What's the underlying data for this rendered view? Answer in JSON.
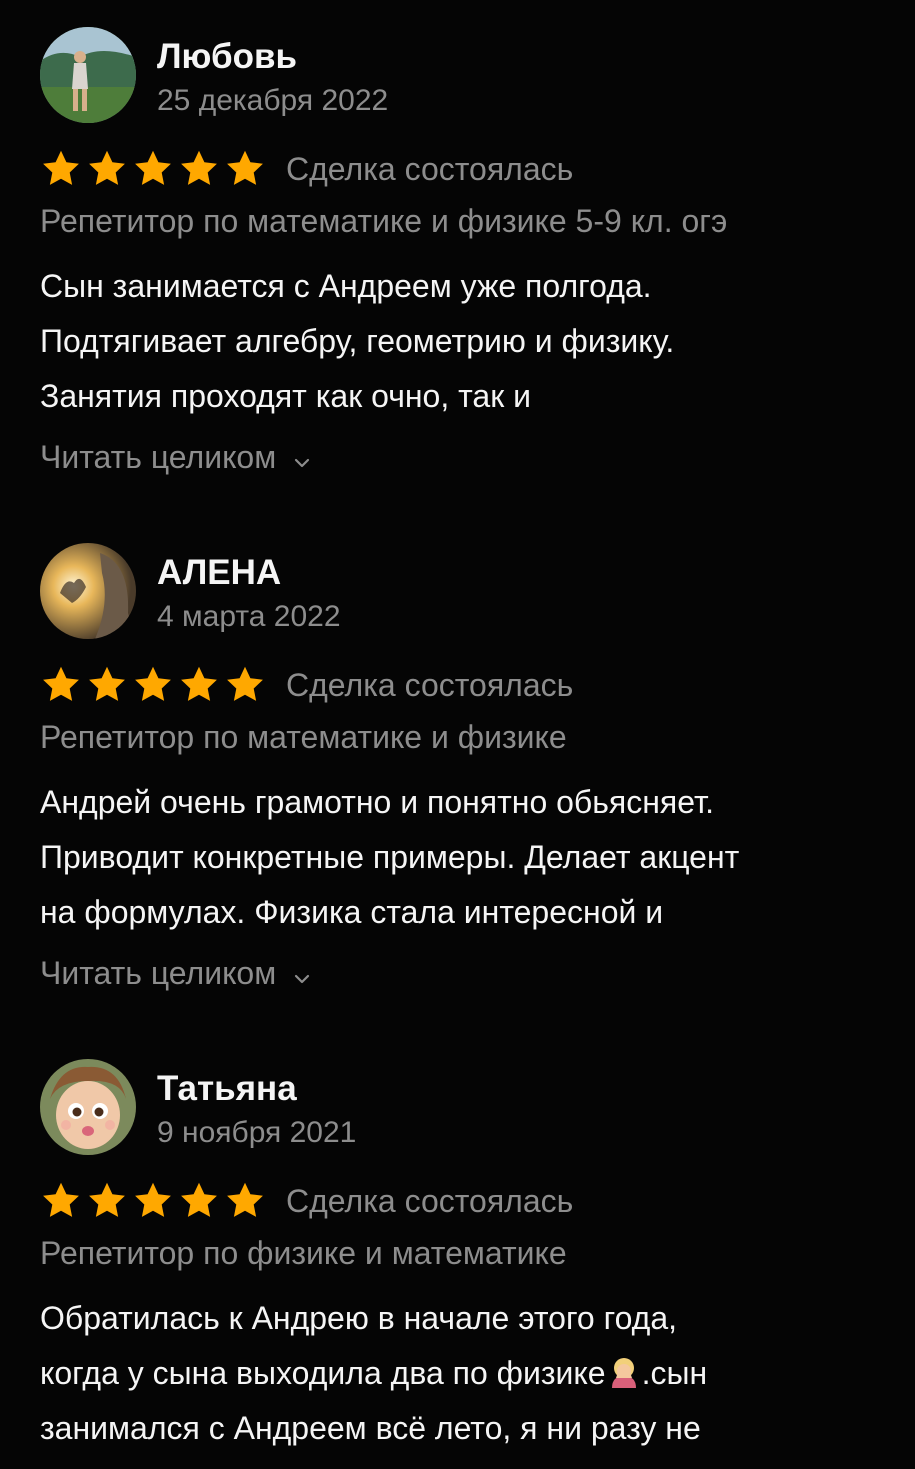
{
  "reviews": [
    {
      "author": "Любовь",
      "date": "25 декабря 2022",
      "rating": 5,
      "status": "Сделка состоялась",
      "service": "Репетитор по математике и физике 5-9 кл. огэ",
      "text_lines": [
        "Сын занимается с Андреем уже полгода.",
        "Подтягивает алгебру, геометрию и физику.",
        "Занятия проходят как очно, так и"
      ],
      "read_more": "Читать целиком"
    },
    {
      "author": "АЛЕНА",
      "date": "4 марта 2022",
      "rating": 5,
      "status": "Сделка состоялась",
      "service": "Репетитор по математике и физике",
      "text_lines": [
        "Андрей очень грамотно и понятно обьясняет.",
        "Приводит конкретные примеры. Делает акцент",
        "на формулах. Физика стала интересной и"
      ],
      "read_more": "Читать целиком"
    },
    {
      "author": "Татьяна",
      "date": "9 ноября 2021",
      "rating": 5,
      "status": "Сделка состоялась",
      "service": "Репетитор по физике и математике",
      "text_lines": [
        "Обратилась к Андрею в начале этого года,",
        "когда у сына выходила два по физике",
        ".сын",
        "занимался с Андреем всё лето, я ни разу не"
      ]
    }
  ],
  "colors": {
    "background": "#050505",
    "star": "#ffa800",
    "secondary_text": "#8d8d8d",
    "primary_text": "#f5f5f5"
  },
  "icons": {
    "star": "star-icon",
    "chevron": "chevron-down-icon",
    "emoji": "face-palm-emoji-icon"
  }
}
